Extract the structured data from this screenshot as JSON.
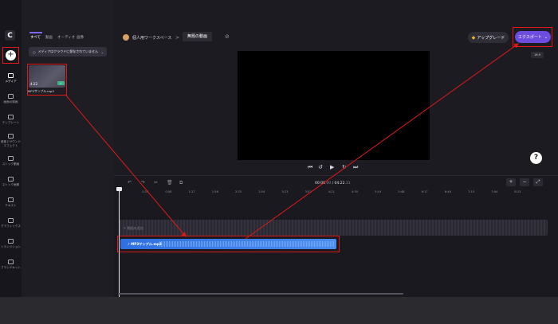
{
  "rail": {
    "logo": "C",
    "items": [
      {
        "label": "メディア",
        "icon": "folder-icon"
      },
      {
        "label": "画面の録画",
        "icon": "camera-icon"
      },
      {
        "label": "テンプレート",
        "icon": "grid-icon"
      },
      {
        "label": "音楽とサウンドエフェクト",
        "icon": "music-icon"
      },
      {
        "label": "ストック動画",
        "icon": "film-icon"
      },
      {
        "label": "ストック画像",
        "icon": "image-icon"
      },
      {
        "label": "テキスト",
        "icon": "text-icon"
      },
      {
        "label": "グラフィックス",
        "icon": "shapes-icon"
      },
      {
        "label": "トランジション",
        "icon": "transition-icon"
      },
      {
        "label": "ブランドキット",
        "icon": "brand-icon"
      }
    ]
  },
  "media": {
    "tabs": [
      "すべて",
      "動画",
      "オーディオ",
      "画像"
    ],
    "upload_note": "メディアはクラウドに保存されていません",
    "item": {
      "duration": "4:22",
      "filename": "MP3サンプル.mp3"
    }
  },
  "header": {
    "workspace": "個人用ワークスペース",
    "separator": ">",
    "project": "無題の動画",
    "upgrade": "アップグレード",
    "export": "エクスポート",
    "ratio": "16:9"
  },
  "timeline": {
    "current": "00:00",
    "current_ms": ".00",
    "total": "04:22",
    "total_ms": ".31",
    "ticks": [
      "0",
      "0:29",
      "0:58",
      "1:27",
      "1:56",
      "2:25",
      "2:54",
      "3:23",
      "3:52",
      "4:21",
      "4:50",
      "5:19",
      "5:48",
      "6:17",
      "6:46",
      "7:15",
      "7:44",
      "8:13"
    ],
    "video_placeholder": "+ 動画を追加",
    "audio_clip": "MP3サンプル.mp3"
  },
  "colors": {
    "accent": "#6c4de0",
    "annotation": "#e01818",
    "audio": "#2f6fe0"
  }
}
